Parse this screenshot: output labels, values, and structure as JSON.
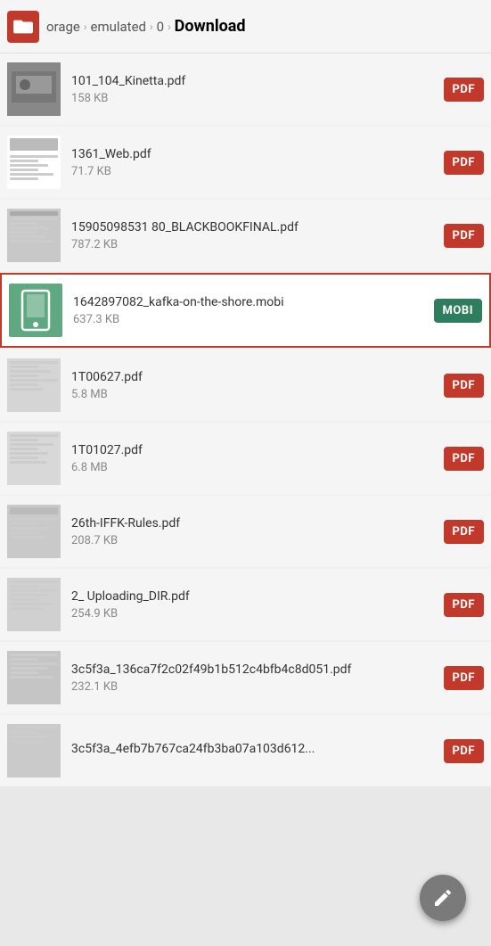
{
  "header": {
    "app_icon": "folder-icon",
    "breadcrumb": [
      {
        "label": "orage",
        "active": false
      },
      {
        "label": "emulated",
        "active": false
      },
      {
        "label": "0",
        "active": false
      },
      {
        "label": "Download",
        "active": true
      }
    ]
  },
  "files": [
    {
      "id": "file-1",
      "name": "101_104_Kinetta.pdf",
      "size": "158 KB",
      "type": "PDF",
      "selected": false,
      "thumb": "kinetta"
    },
    {
      "id": "file-2",
      "name": "1361_Web.pdf",
      "size": "71.7 KB",
      "type": "PDF",
      "selected": false,
      "thumb": "web"
    },
    {
      "id": "file-3",
      "name": "15905098531 80_BLACKBOOKFINAL.pdf",
      "size": "787.2 KB",
      "type": "PDF",
      "selected": false,
      "thumb": "black"
    },
    {
      "id": "file-4",
      "name": "1642897082_kafka-on-the-shore.mobi",
      "size": "637.3 KB",
      "type": "MOBI",
      "selected": true,
      "thumb": "mobi"
    },
    {
      "id": "file-5",
      "name": "1T00627.pdf",
      "size": "5.8 MB",
      "type": "PDF",
      "selected": false,
      "thumb": "1t00"
    },
    {
      "id": "file-6",
      "name": "1T01027.pdf",
      "size": "6.8 MB",
      "type": "PDF",
      "selected": false,
      "thumb": "1t01"
    },
    {
      "id": "file-7",
      "name": "26th-IFFK-Rules.pdf",
      "size": "208.7 KB",
      "type": "PDF",
      "selected": false,
      "thumb": "iffk"
    },
    {
      "id": "file-8",
      "name": "2_ Uploading_DIR.pdf",
      "size": "254.9 KB",
      "type": "PDF",
      "selected": false,
      "thumb": "upload"
    },
    {
      "id": "file-9",
      "name": "3c5f3a_136ca7f2c02f49b1b512c4bfb4c8d051.pdf",
      "size": "232.1 KB",
      "type": "PDF",
      "selected": false,
      "thumb": "3c5f"
    },
    {
      "id": "file-10",
      "name": "3c5f3a_4efb7b767ca24fb3ba07a103d612...",
      "size": "",
      "type": "PDF",
      "selected": false,
      "thumb": "3c5f2"
    }
  ],
  "fab": {
    "label": "edit",
    "icon": "edit-icon"
  }
}
